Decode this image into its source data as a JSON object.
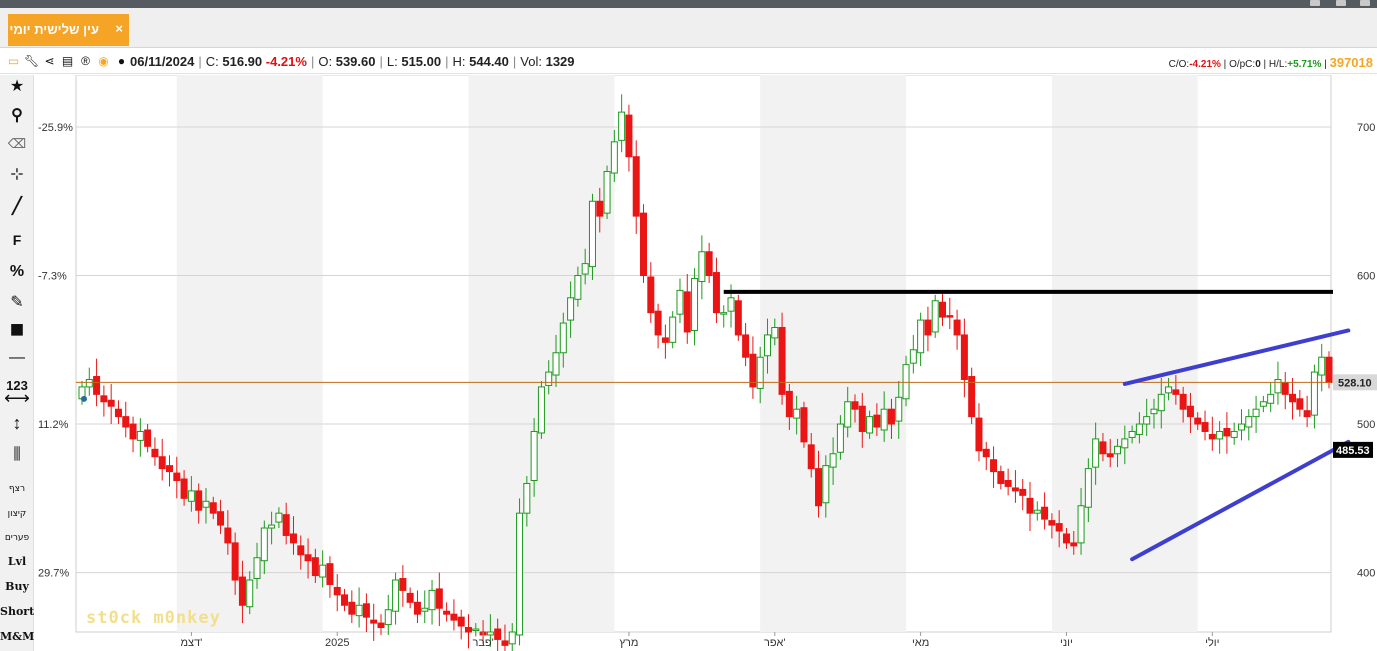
{
  "tab": {
    "label": "עין שלישית יומי",
    "close_label": "×"
  },
  "infobar": {
    "date": "06/11/2024",
    "close_label": "C:",
    "close_value": "516.90",
    "change": "-4.21%",
    "open_label": "O:",
    "open_value": "539.60",
    "low_label": "L:",
    "low_value": "515.00",
    "high_label": "H:",
    "high_value": "544.40",
    "vol_label": "Vol:",
    "vol_value": "1329",
    "icons": [
      "window-icon",
      "wrench-icon",
      "share-icon",
      "excel-icon",
      "registered-icon",
      "target-icon",
      "comment-icon"
    ]
  },
  "stats": {
    "co_label": "C/O:",
    "co_value": "-4.21%",
    "opc_label": "O/pC:",
    "opc_value": "0",
    "hl_label": "H/L:",
    "hl_value": "+5.71%",
    "code": "397018"
  },
  "toolbar": {
    "star": "★",
    "search": "⚲",
    "eraser": "⌫",
    "cross": "⊹",
    "line": "╱",
    "fib": "F",
    "percent": "%",
    "edit": "✎",
    "color": "■",
    "hline": "—",
    "count": "123",
    "measure_h": "⟷",
    "measure_v": "↕",
    "candles": "⫼",
    "rezef": "רצף",
    "kitzun": "קיצון",
    "paarim": "פערים",
    "lvl": "Lvl",
    "buy": "Buy",
    "short": "Short",
    "mm": "M&M"
  },
  "watermark": "st0ck m0nkey",
  "chart_data": {
    "type": "candlestick",
    "y_axis_right": {
      "ticks": [
        400,
        500,
        600,
        700
      ],
      "range": [
        360,
        735
      ]
    },
    "y_axis_left": {
      "ticks": [
        "29.7%",
        "11.2%",
        "-7.3%",
        "-25.9%"
      ]
    },
    "x_labels": [
      "דצמ'",
      "2025",
      "פבר'",
      "מרץ",
      "אפר'",
      "מאי",
      "יוני",
      "יולי"
    ],
    "x_label_index": [
      15,
      35,
      55,
      75,
      95,
      115,
      135,
      155
    ],
    "reference_price": 528.1,
    "reference_price_label": "528.10",
    "support_price_label": "485.53",
    "colors": {
      "up": "#1c9a1c",
      "down": "#ea1515",
      "reference": "#c26a1a",
      "resistance": "#000000",
      "channel": "#3f3fcf"
    },
    "resistance_line": {
      "from_index": 88,
      "to_index": 171,
      "price": 589
    },
    "channel_upper": {
      "from": [
        143,
        527
      ],
      "to": [
        172,
        563
      ]
    },
    "channel_lower": {
      "from": [
        144,
        409
      ],
      "to": [
        172,
        488
      ]
    },
    "closes": [
      525,
      530,
      520,
      515,
      512,
      505,
      498,
      490,
      495,
      485,
      478,
      470,
      468,
      462,
      450,
      455,
      442,
      448,
      440,
      432,
      420,
      395,
      378,
      395,
      410,
      430,
      432,
      440,
      425,
      420,
      412,
      408,
      398,
      405,
      392,
      385,
      378,
      372,
      378,
      370,
      366,
      363,
      375,
      395,
      388,
      380,
      372,
      376,
      388,
      376,
      372,
      368,
      364,
      360,
      362,
      358,
      360,
      355,
      351,
      360,
      440,
      460,
      495,
      525,
      535,
      548,
      568,
      585,
      600,
      608,
      650,
      640,
      670,
      690,
      710,
      680,
      640,
      600,
      575,
      560,
      555,
      572,
      590,
      562,
      598,
      616,
      600,
      575,
      575,
      585,
      560,
      545,
      525,
      545,
      560,
      565,
      520,
      505,
      510,
      488,
      470,
      445,
      472,
      480,
      500,
      515,
      510,
      495,
      505,
      498,
      510,
      500,
      518,
      540,
      550,
      570,
      560,
      583,
      572,
      572,
      560,
      530,
      505,
      482,
      478,
      468,
      460,
      458,
      455,
      452,
      440,
      442,
      436,
      432,
      428,
      420,
      418,
      445,
      470,
      490,
      480,
      478,
      485,
      490,
      495,
      500,
      505,
      510,
      520,
      525,
      520,
      510,
      505,
      500,
      495,
      490,
      495,
      492,
      495,
      500,
      505,
      510,
      515,
      520,
      530,
      520,
      515,
      510,
      505,
      535,
      545,
      528
    ]
  }
}
